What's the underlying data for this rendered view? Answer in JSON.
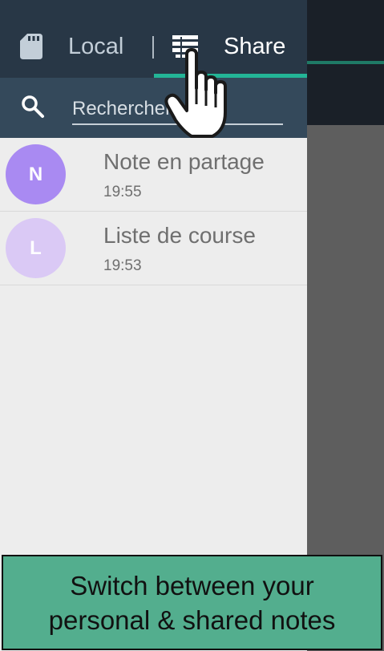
{
  "tabs": {
    "local": {
      "label": "Local",
      "icon": "sd-card-icon"
    },
    "share": {
      "label": "Share",
      "icon": "shared-storage-icon",
      "selected": true
    }
  },
  "search": {
    "placeholder": "Rechercher",
    "value": "",
    "icon": "search-icon"
  },
  "notes": [
    {
      "initial": "N",
      "title": "Note en partage",
      "time": "19:55",
      "avatar_color": "#a98af2"
    },
    {
      "initial": "L",
      "title": "Liste de course",
      "time": "19:53",
      "avatar_color": "#dac9f5"
    }
  ],
  "colors": {
    "tabbar": "#283746",
    "searchbar": "#34495b",
    "accent": "#23b597",
    "banner": "#53ae8e"
  },
  "banner": {
    "text": "Switch between your\npersonal & shared notes"
  },
  "overlay": {
    "icon": "hand-pointer-icon"
  }
}
